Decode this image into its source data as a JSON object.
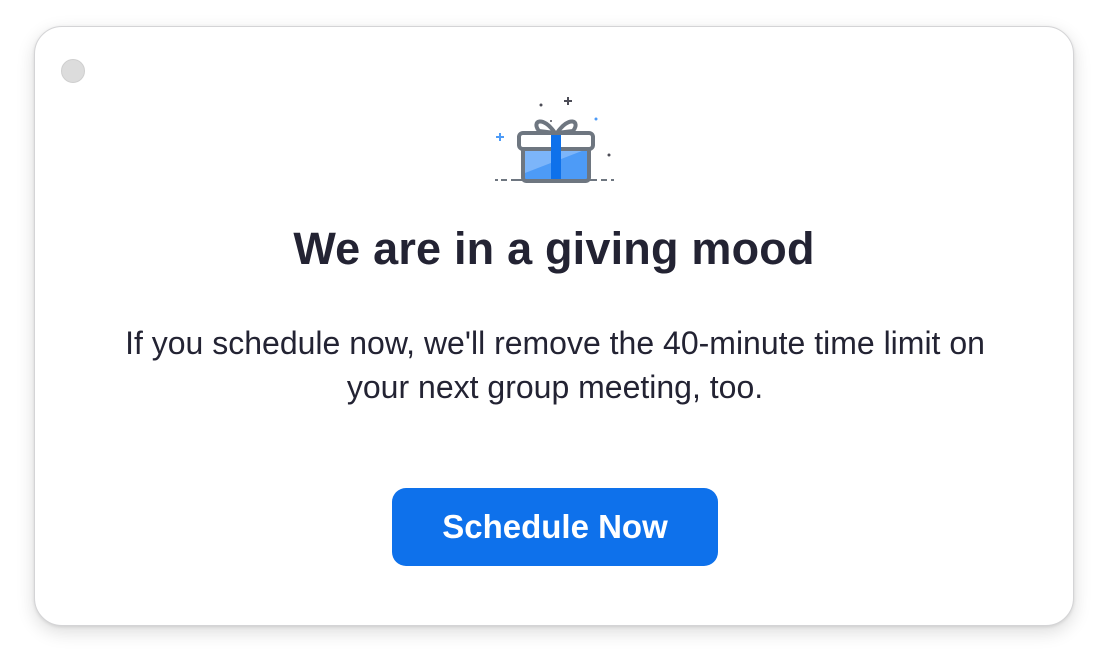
{
  "dialog": {
    "title": "We are in a giving mood",
    "message": "If you schedule now, we'll remove the 40-minute time limit on your next group meeting, too.",
    "primary_button_label": "Schedule Now",
    "icon": "gift-icon",
    "close_control_icon": "close-dot-icon"
  },
  "colors": {
    "accent": "#0e71eb",
    "text": "#232333",
    "gift_blue": "#4d9bf7",
    "gift_outline": "#6e7680"
  }
}
